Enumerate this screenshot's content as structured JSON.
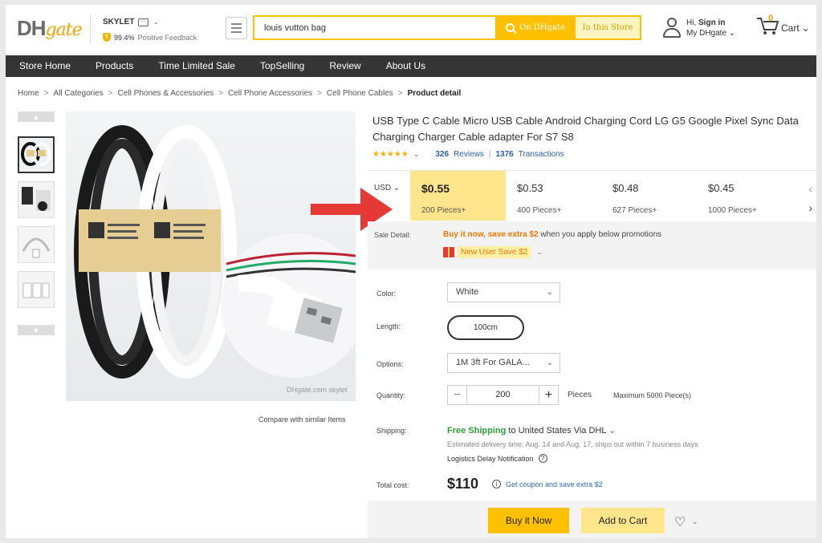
{
  "header": {
    "logo_dh": "DH",
    "logo_gate": "gate",
    "store_name": "SKYLET",
    "feedback_pct": "99.4%",
    "feedback_label": "Positive Feedback",
    "search_value": "louis vutton bag",
    "search_btn_dh": "On DHgate",
    "search_btn_store": "In this Store",
    "greeting": "Hi,",
    "sign_in": "Sign in",
    "my_dhgate": "My DHgate",
    "cart_count": "0",
    "cart_label": "Cart"
  },
  "nav": [
    "Store Home",
    "Products",
    "Time Limited Sale",
    "TopSelling",
    "Review",
    "About Us"
  ],
  "breadcrumb": [
    "Home",
    "All Categories",
    "Cell Phones & Accessories",
    "Cell Phone Accessories",
    "Cell Phone Cables",
    "Product detail"
  ],
  "gallery": {
    "compare": "Compare with similar Items",
    "watermark": "DHgate.com skylet"
  },
  "product": {
    "title": "USB Type C Cable Micro USB Cable Android Charging Cord LG G5 Google Pixel Sync Data Charging Charger Cable adapter For S7 S8",
    "stars": "★★★★★",
    "reviews_count": "326",
    "reviews_label": "Reviews",
    "transactions_count": "1376",
    "transactions_label": "Transactions"
  },
  "pricing": {
    "currency": "USD",
    "tiers": [
      {
        "price": "$0.55",
        "qty": "200 Pieces+"
      },
      {
        "price": "$0.53",
        "qty": "400 Pieces+"
      },
      {
        "price": "$0.48",
        "qty": "627 Pieces+"
      },
      {
        "price": "$0.45",
        "qty": "1000 Pieces+"
      }
    ]
  },
  "sale": {
    "label": "Sale Detail:",
    "promo_bold": "Buy it now, save extra $2",
    "promo_rest": " when you apply below promotions",
    "coupon": "New User Save $2"
  },
  "options": {
    "color_label": "Color:",
    "color_value": "White",
    "length_label": "Length:",
    "length_value": "100cm",
    "options_label": "Options:",
    "options_value": "1M 3ft For GALA...",
    "quantity_label": "Quantity:",
    "quantity_value": "200",
    "pieces": "Pieces",
    "max": "Maximum 5000 Piece(s)",
    "shipping_label": "Shipping:",
    "free_shipping": "Free Shipping",
    "ship_to": " to United States Via DHL",
    "estimated": "Estimated delivery time: Aug. 14 and Aug. 17, ships out within 7 business days",
    "logistics": "Logistics Delay Notification",
    "total_label": "Total cost:",
    "total_value": "$110",
    "coupon_link": "Get coupon and save extra $2"
  },
  "actions": {
    "buy_now": "Buy it Now",
    "add_to_cart": "Add to Cart"
  },
  "colors": {
    "accent": "#ffc000",
    "nav_bg": "#353535",
    "promo": "#f07800",
    "free_shipping": "#2e9e3a",
    "arrow": "#e53935"
  }
}
